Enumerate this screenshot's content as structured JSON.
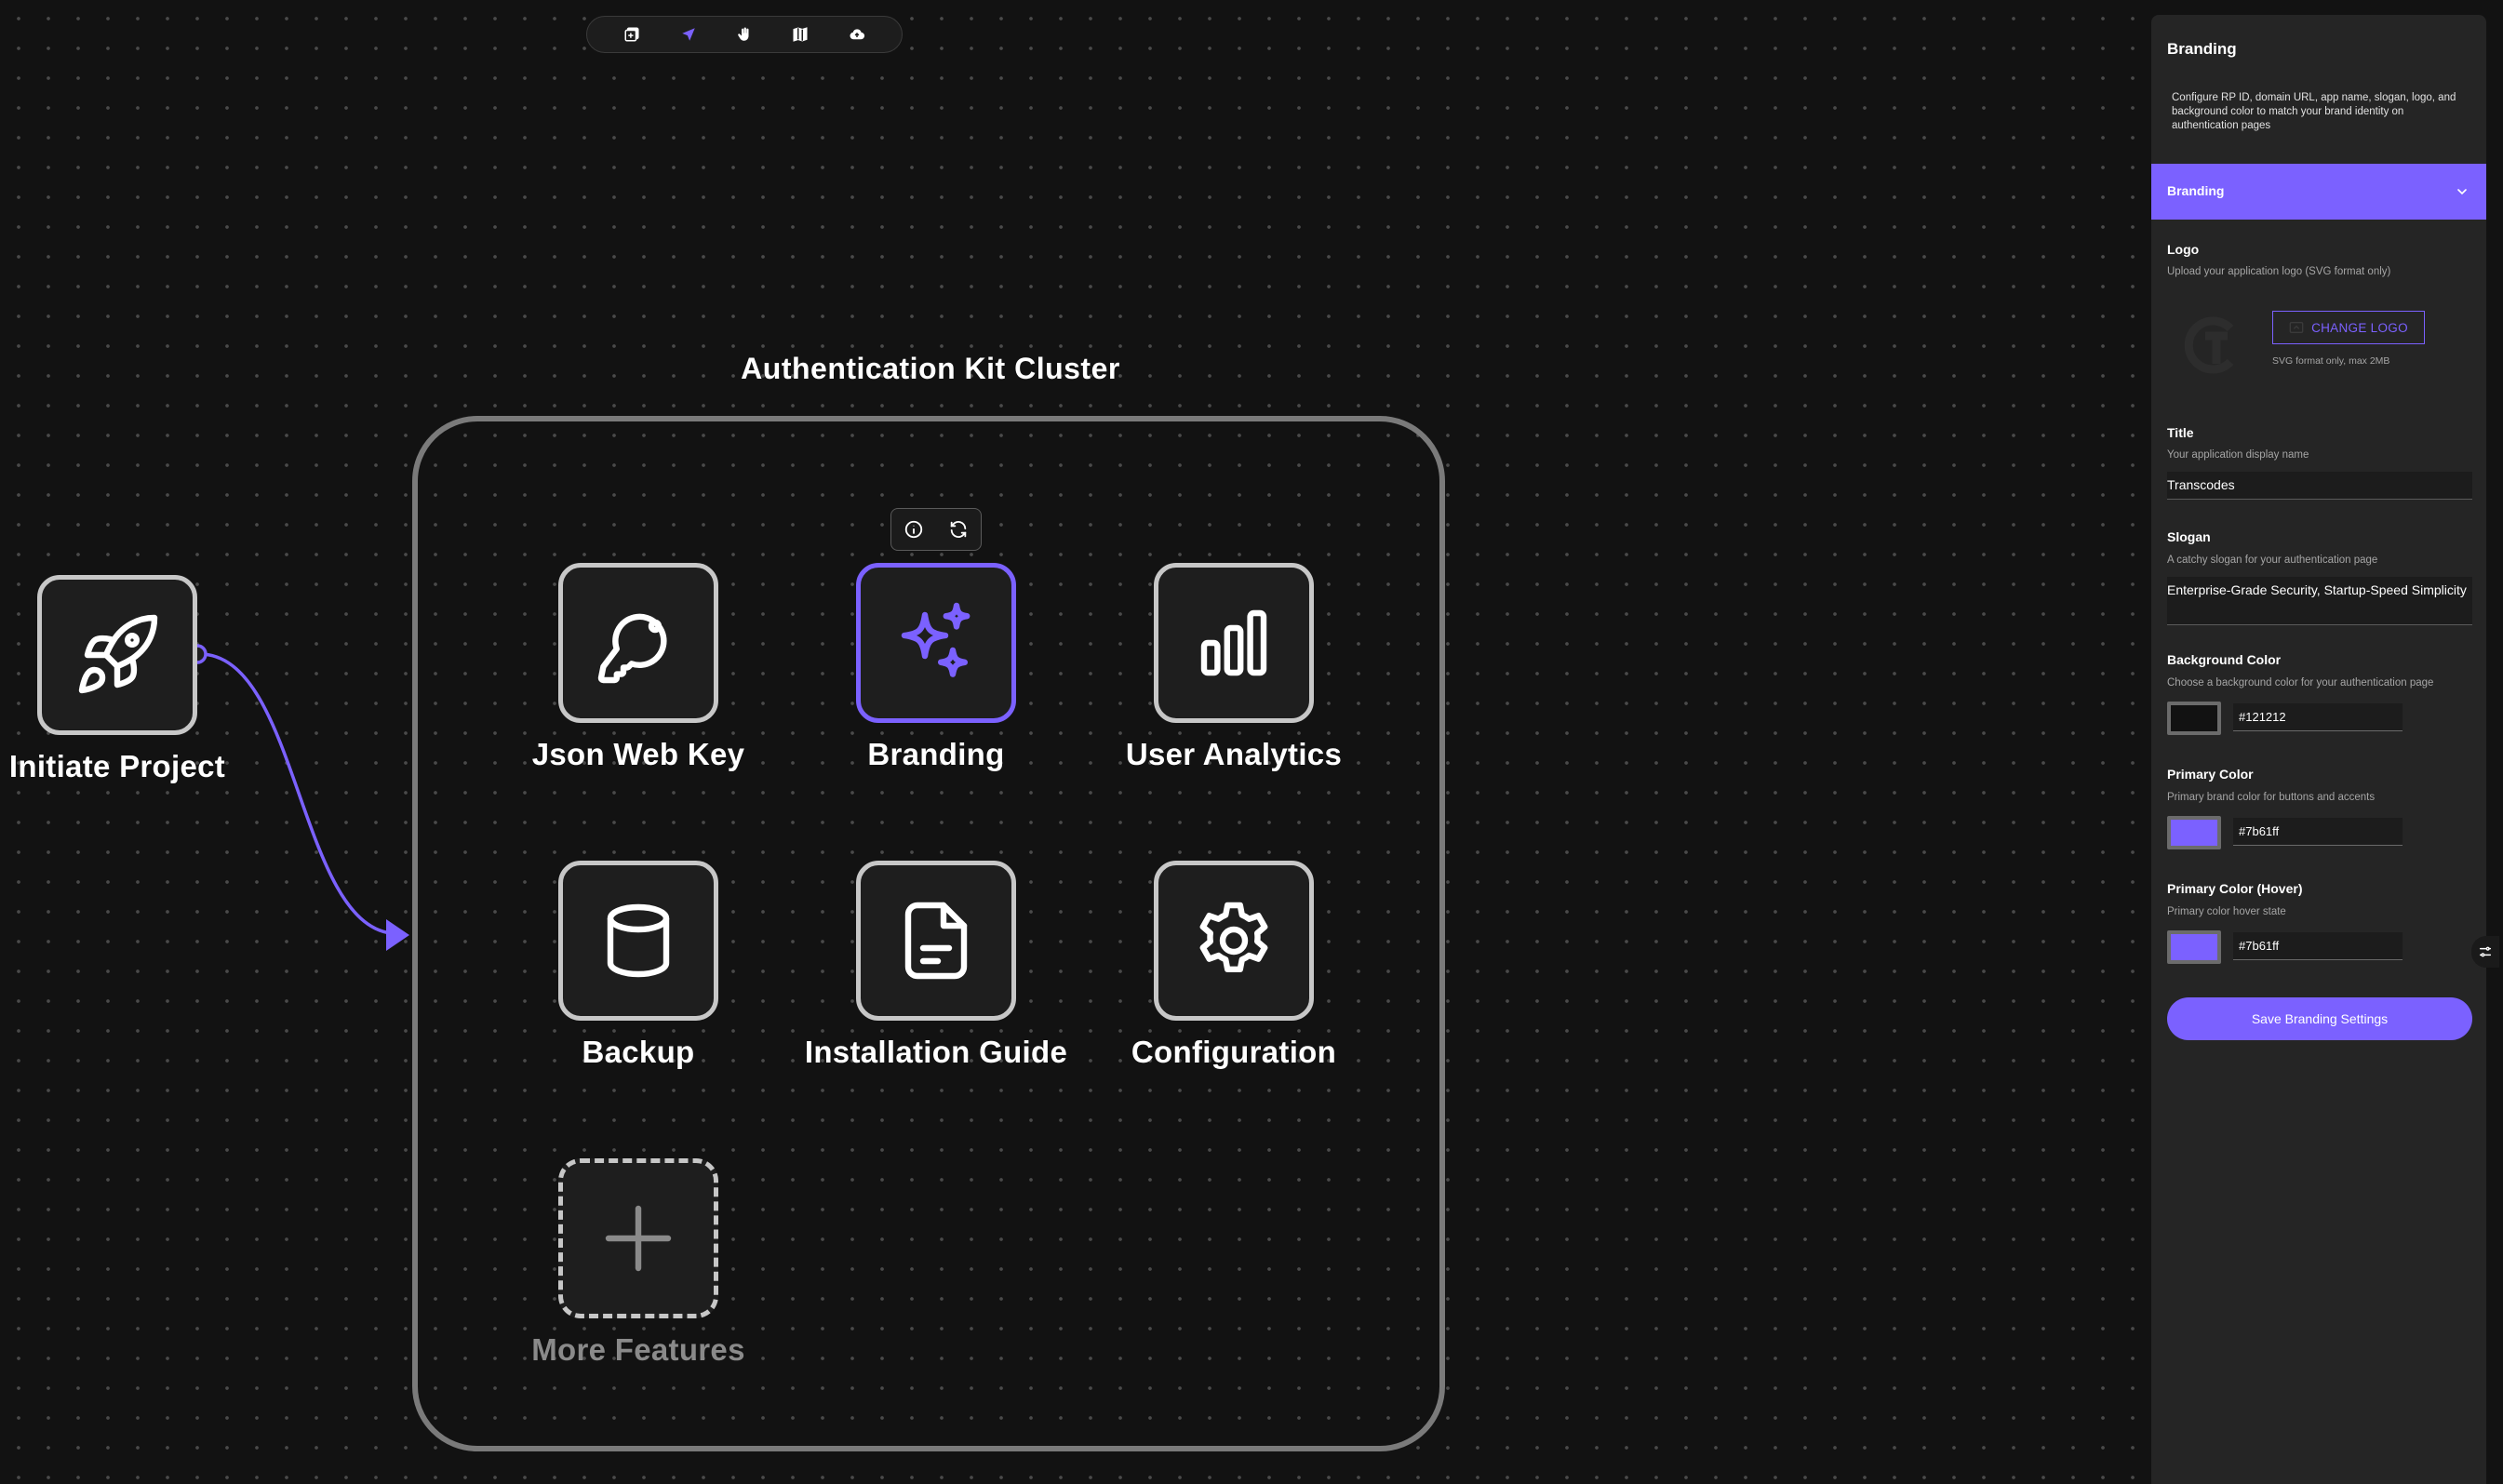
{
  "toolbar": {
    "icons": [
      "add-node-icon",
      "pointer-icon",
      "hand-icon",
      "map-icon",
      "cloud-upload-icon"
    ]
  },
  "cluster": {
    "title": "Authentication Kit Cluster"
  },
  "start_node": {
    "label": "Initiate Project",
    "icon": "rocket-icon"
  },
  "nodes": [
    {
      "label": "Json Web Key",
      "icon": "key-icon"
    },
    {
      "label": "Branding",
      "icon": "sparkles-icon"
    },
    {
      "label": "User Analytics",
      "icon": "bar-chart-icon"
    },
    {
      "label": "Backup",
      "icon": "database-icon"
    },
    {
      "label": "Installation Guide",
      "icon": "document-icon"
    },
    {
      "label": "Configuration",
      "icon": "gear-icon"
    },
    {
      "label": "More Features",
      "icon": "plus-icon"
    }
  ],
  "panel": {
    "title": "Branding",
    "description": "Configure RP ID, domain URL, app name, slogan, logo, and background color to match your brand identity on authentication pages",
    "section_label": "Branding",
    "logo": {
      "label": "Logo",
      "help": "Upload your application logo (SVG format only)",
      "button": "CHANGE LOGO",
      "note": "SVG format only, max 2MB"
    },
    "title_field": {
      "label": "Title",
      "help": "Your application display name",
      "value": "Transcodes"
    },
    "slogan_field": {
      "label": "Slogan",
      "help": "A catchy slogan for your authentication page",
      "value": "Enterprise-Grade Security, Startup-Speed Simplicity"
    },
    "background_color": {
      "label": "Background Color",
      "help": "Choose a background color for your authentication page",
      "value": "#121212"
    },
    "primary_color": {
      "label": "Primary Color",
      "help": "Primary brand color for buttons and accents",
      "value": "#7b61ff"
    },
    "primary_hover": {
      "label": "Primary Color (Hover)",
      "help": "Primary color hover state",
      "value": "#7b61ff"
    },
    "save_button": "Save Branding Settings"
  },
  "colors": {
    "accent": "#7b61ff",
    "canvas_bg": "#121212",
    "panel_bg": "#252525"
  }
}
